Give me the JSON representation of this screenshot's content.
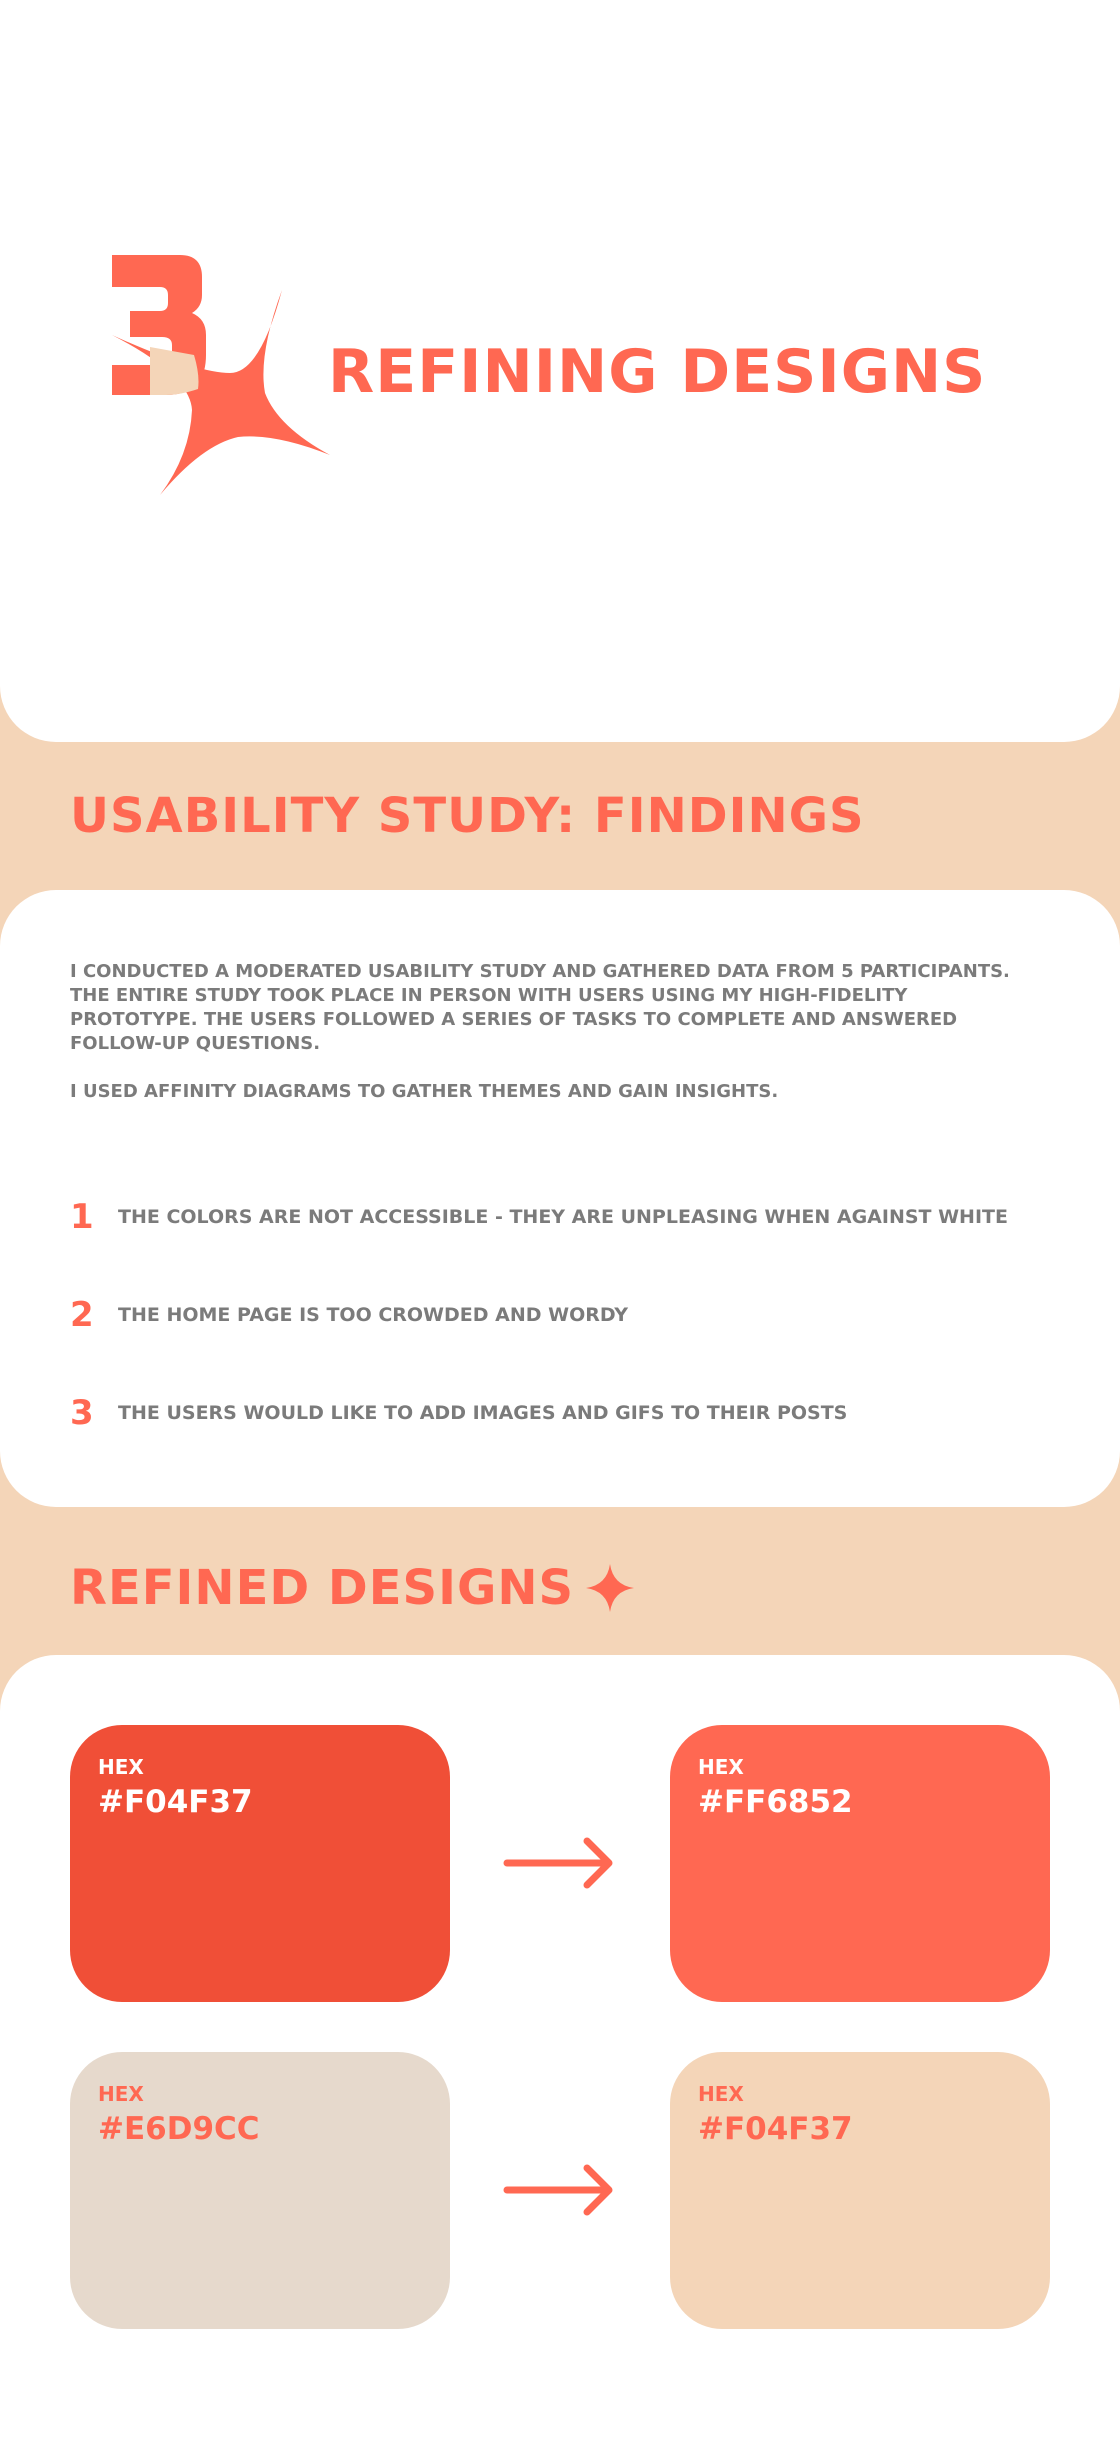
{
  "hero": {
    "step_number": "3",
    "title": "REFINING DESIGNS"
  },
  "findings_section": {
    "title": "USABILITY STUDY: FINDINGS",
    "intro_paragraphs": [
      "I CONDUCTED A MODERATED USABILITY STUDY AND GATHERED DATA FROM 5 PARTICIPANTS. THE ENTIRE STUDY TOOK PLACE IN PERSON WITH USERS USING MY HIGH-FIDELITY PROTOTYPE. THE USERS FOLLOWED A SERIES OF TASKS TO COMPLETE AND ANSWERED FOLLOW-UP QUESTIONS.",
      "I USED AFFINITY DIAGRAMS TO GATHER THEMES AND GAIN INSIGHTS."
    ],
    "findings": [
      {
        "number": "1",
        "text": "THE COLORS ARE NOT ACCESSIBLE  - THEY ARE UNPLEASING WHEN AGAINST WHITE"
      },
      {
        "number": "2",
        "text": "THE HOME PAGE IS TOO CROWDED AND WORDY"
      },
      {
        "number": "3",
        "text": "THE USERS WOULD LIKE TO ADD IMAGES AND GIFS TO THEIR POSTS"
      }
    ]
  },
  "refined_section": {
    "title": "REFINED DESIGNS",
    "icon": "sparkle-icon",
    "arrow_icon": "arrow-right-icon",
    "swatch_pairs": [
      {
        "before": {
          "label": "HEX",
          "value": "#F04F37",
          "bg": "#f04f37",
          "text_color": "#ffffff"
        },
        "after": {
          "label": "HEX",
          "value": "#FF6852",
          "bg": "#ff6852",
          "text_color": "#ffffff"
        }
      },
      {
        "before": {
          "label": "HEX",
          "value": "#E6D9CC",
          "bg": "#e6d9cc",
          "text_color": "#ff6852"
        },
        "after": {
          "label": "HEX",
          "value": "#F04F37",
          "bg": "#f4d5b8",
          "text_color": "#ff6852"
        }
      }
    ]
  },
  "colors": {
    "accent": "#ff6852",
    "accent_dark": "#f04f37",
    "peach": "#f4d5b8",
    "text_gray": "#7b7b7b"
  }
}
